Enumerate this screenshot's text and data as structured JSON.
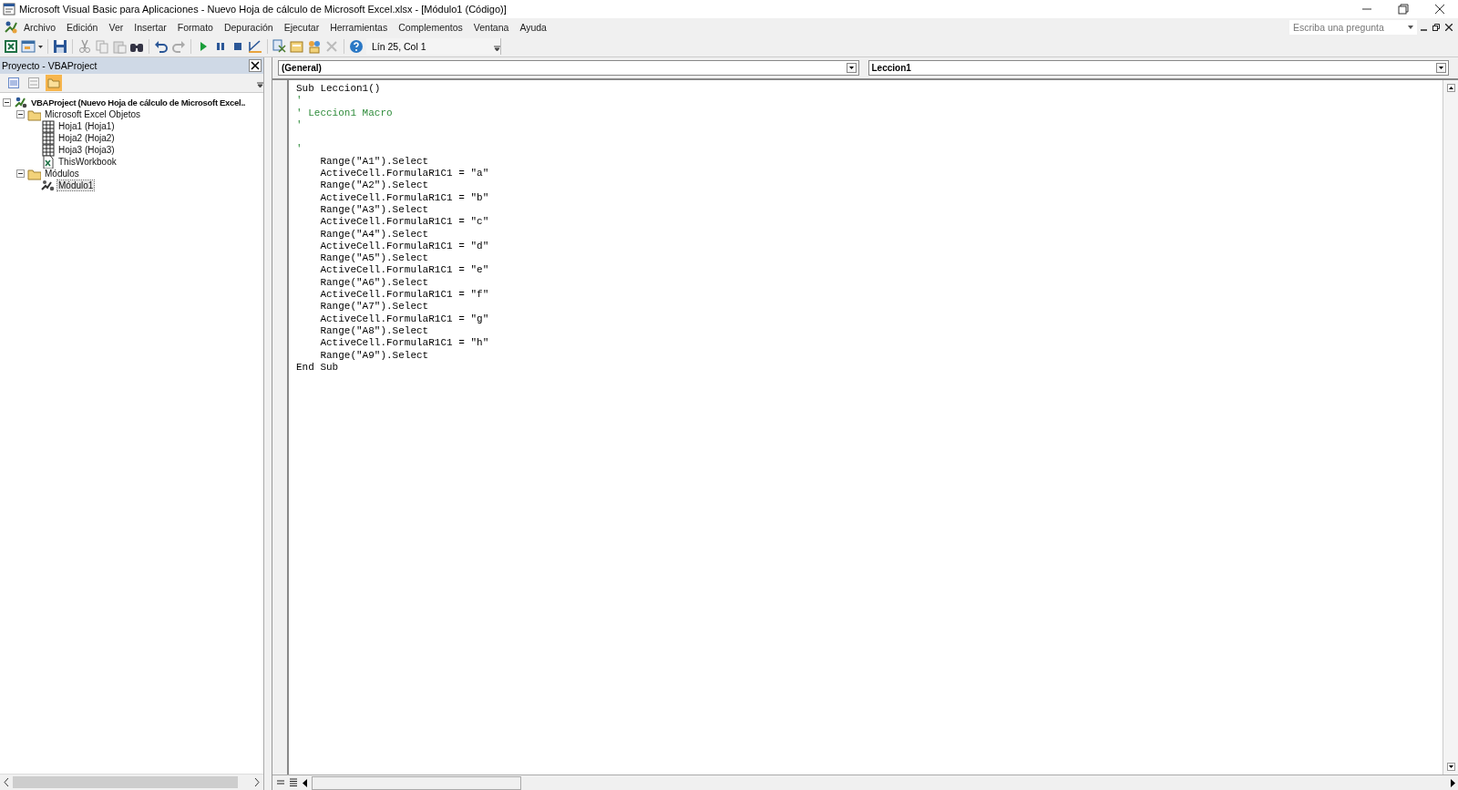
{
  "window": {
    "title": "Microsoft Visual Basic para Aplicaciones - Nuevo Hoja de cálculo de Microsoft Excel.xlsx - [Módulo1 (Código)]"
  },
  "menu": [
    "Archivo",
    "Edición",
    "Ver",
    "Insertar",
    "Formato",
    "Depuración",
    "Ejecutar",
    "Herramientas",
    "Complementos",
    "Ventana",
    "Ayuda"
  ],
  "help_box": {
    "placeholder": "Escriba una pregunta"
  },
  "toolbar": {
    "position": "Lín 25, Col 1"
  },
  "project_pane": {
    "title": "Proyecto - VBAProject",
    "toggle_folders": {
      "selected": true
    },
    "tree": [
      {
        "label": "VBAProject (Nuevo Hoja de cálculo de Microsoft Excel..",
        "kind": "project",
        "expanded": true,
        "selected": false,
        "children": [
          {
            "label": "Microsoft Excel Objetos",
            "kind": "folder",
            "expanded": true,
            "selected": false,
            "children": [
              {
                "label": "Hoja1 (Hoja1)",
                "kind": "sheet",
                "selected": false
              },
              {
                "label": "Hoja2 (Hoja2)",
                "kind": "sheet",
                "selected": false
              },
              {
                "label": "Hoja3 (Hoja3)",
                "kind": "sheet",
                "selected": false
              },
              {
                "label": "ThisWorkbook",
                "kind": "workbook",
                "selected": false
              }
            ]
          },
          {
            "label": "Módulos",
            "kind": "folder",
            "expanded": true,
            "selected": false,
            "children": [
              {
                "label": "Módulo1",
                "kind": "module",
                "selected": true
              }
            ]
          }
        ]
      }
    ]
  },
  "code_pane": {
    "object": "(General)",
    "procedure": "Leccion1",
    "lines": [
      {
        "kind": "code",
        "text": "Sub Leccion1()"
      },
      {
        "kind": "comment",
        "text": "'"
      },
      {
        "kind": "comment",
        "text": "' Leccion1 Macro"
      },
      {
        "kind": "comment",
        "text": "'"
      },
      {
        "kind": "blank"
      },
      {
        "kind": "comment",
        "text": "'"
      },
      {
        "kind": "code",
        "text": "    Range(\"A1\").Select"
      },
      {
        "kind": "code",
        "text": "    ActiveCell.FormulaR1C1 = \"a\""
      },
      {
        "kind": "code",
        "text": "    Range(\"A2\").Select"
      },
      {
        "kind": "code",
        "text": "    ActiveCell.FormulaR1C1 = \"b\""
      },
      {
        "kind": "code",
        "text": "    Range(\"A3\").Select"
      },
      {
        "kind": "code",
        "text": "    ActiveCell.FormulaR1C1 = \"c\""
      },
      {
        "kind": "code",
        "text": "    Range(\"A4\").Select"
      },
      {
        "kind": "code",
        "text": "    ActiveCell.FormulaR1C1 = \"d\""
      },
      {
        "kind": "code",
        "text": "    Range(\"A5\").Select"
      },
      {
        "kind": "code",
        "text": "    ActiveCell.FormulaR1C1 = \"e\""
      },
      {
        "kind": "code",
        "text": "    Range(\"A6\").Select"
      },
      {
        "kind": "code",
        "text": "    ActiveCell.FormulaR1C1 = \"f\""
      },
      {
        "kind": "code",
        "text": "    Range(\"A7\").Select"
      },
      {
        "kind": "code",
        "text": "    ActiveCell.FormulaR1C1 = \"g\""
      },
      {
        "kind": "code",
        "text": "    Range(\"A8\").Select"
      },
      {
        "kind": "code",
        "text": "    ActiveCell.FormulaR1C1 = \"h\""
      },
      {
        "kind": "code",
        "text": "    Range(\"A9\").Select"
      },
      {
        "kind": "code",
        "text": "End Sub"
      }
    ]
  }
}
